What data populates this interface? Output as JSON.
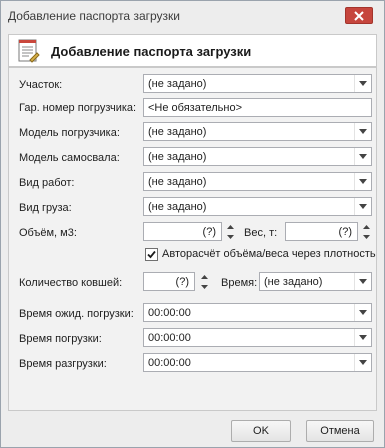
{
  "window": {
    "title": "Добавление паспорта загрузки"
  },
  "header": {
    "title": "Добавление паспорта загрузки"
  },
  "form": {
    "section_label": "Участок:",
    "section_value": "(не задано)",
    "loader_number_label": "Гар. номер погрузчика:",
    "loader_number_value": "<Не обязательно>",
    "loader_model_label": "Модель погрузчика:",
    "loader_model_value": "(не задано)",
    "truck_model_label": "Модель самосвала:",
    "truck_model_value": "(не задано)",
    "work_type_label": "Вид работ:",
    "work_type_value": "(не задано)",
    "cargo_type_label": "Вид груза:",
    "cargo_type_value": "(не задано)",
    "volume_label": "Объём, м3:",
    "volume_value": "(?)",
    "weight_label": "Вес, т:",
    "weight_value": "(?)",
    "autocalc_label": "Авторасчёт объёма/веса через плотность",
    "bucket_count_label": "Количество ковшей:",
    "bucket_count_value": "(?)",
    "time_label": "Время:",
    "time_value": "(не задано)",
    "wait_time_label": "Время ожид. погрузки:",
    "wait_time_value": "00:00:00",
    "load_time_label": "Время погрузки:",
    "load_time_value": "00:00:00",
    "unload_time_label": "Время разгрузки:",
    "unload_time_value": "00:00:00"
  },
  "buttons": {
    "ok": "OK",
    "cancel": "Отмена"
  },
  "colors": {
    "close_button": "#c6463d",
    "checkbox_mark": "#1a1a1a"
  },
  "icons": [
    "close-icon",
    "document-icon",
    "chevron-down-icon",
    "spin-up-icon",
    "spin-down-icon",
    "checkmark-icon"
  ]
}
